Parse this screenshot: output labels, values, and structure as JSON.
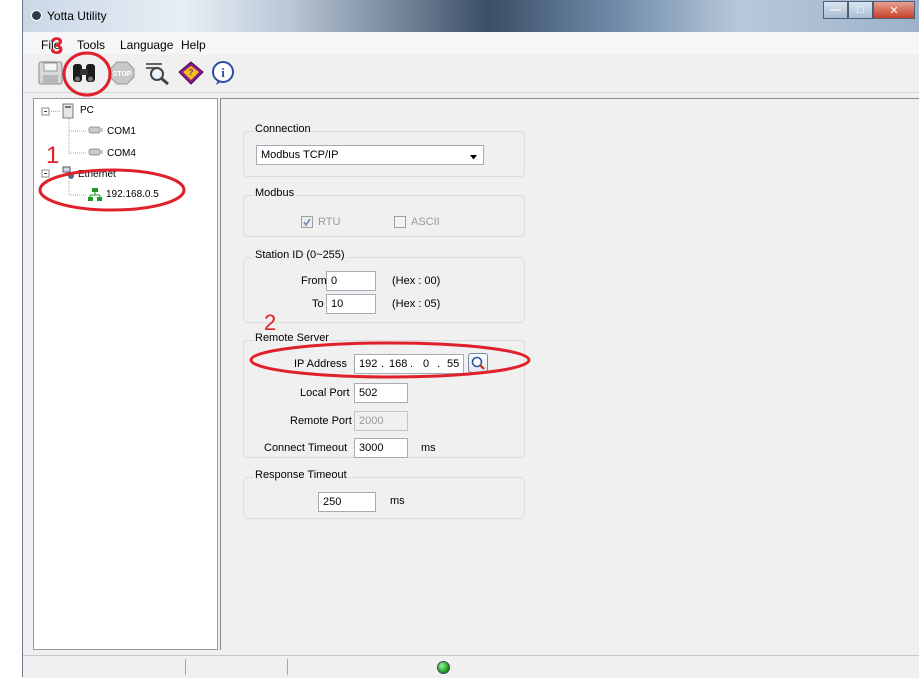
{
  "window": {
    "title": "Yotta Utility"
  },
  "menu": {
    "file": "File",
    "tools": "Tools",
    "language": "Language",
    "help": "Help"
  },
  "tree": {
    "pc": "PC",
    "com1": "COM1",
    "com4": "COM4",
    "ethernet": "Ethernet",
    "device": "192.168.0.5"
  },
  "connection": {
    "title": "Connection",
    "selected": "Modbus TCP/IP"
  },
  "modbus": {
    "title": "Modbus",
    "rtu": "RTU",
    "ascii": "ASCII"
  },
  "station": {
    "title": "Station ID (0~255)",
    "from_label": "From",
    "from_value": "0",
    "from_hex": "(Hex : 00)",
    "to_label": "To",
    "to_value": "10",
    "to_hex": "(Hex : 05)"
  },
  "remote": {
    "title": "Remote Server",
    "ip_label": "IP Address",
    "ip1": "192",
    "ip2": "168",
    "ip3": "0",
    "ip4": "55",
    "local_port_label": "Local Port",
    "local_port": "502",
    "remote_port_label": "Remote Port",
    "remote_port": "2000",
    "timeout_label": "Connect Timeout",
    "timeout": "3000",
    "ms": "ms"
  },
  "response": {
    "title": "Response Timeout",
    "value": "250",
    "ms": "ms"
  },
  "annotations": {
    "one": "1",
    "two": "2",
    "three": "3"
  },
  "colors": {
    "annotation": "#e0202a",
    "status_led": "#1fa31f"
  }
}
